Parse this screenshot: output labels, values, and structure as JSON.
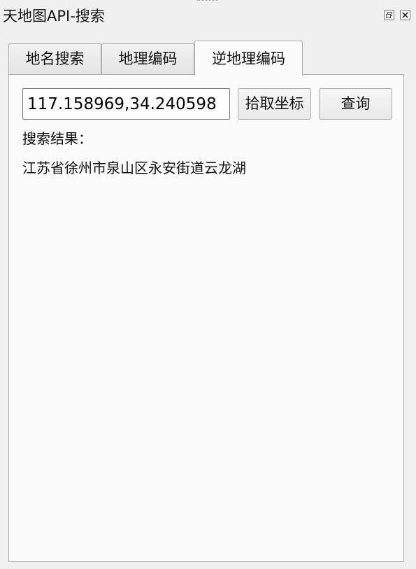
{
  "window": {
    "title": "天地图API-搜索"
  },
  "tabs": [
    {
      "label": "地名搜索"
    },
    {
      "label": "地理编码"
    },
    {
      "label": "逆地理编码",
      "active": true
    }
  ],
  "reverse_geocode": {
    "coordinate_value": "117.158969,34.240598",
    "pick_button_label": "拾取坐标",
    "query_button_label": "查询",
    "result_label": "搜索结果：",
    "result_text": "江苏省徐州市泉山区永安街道云龙湖"
  },
  "icons": {
    "float": "float-window-icon",
    "close": "close-icon"
  }
}
